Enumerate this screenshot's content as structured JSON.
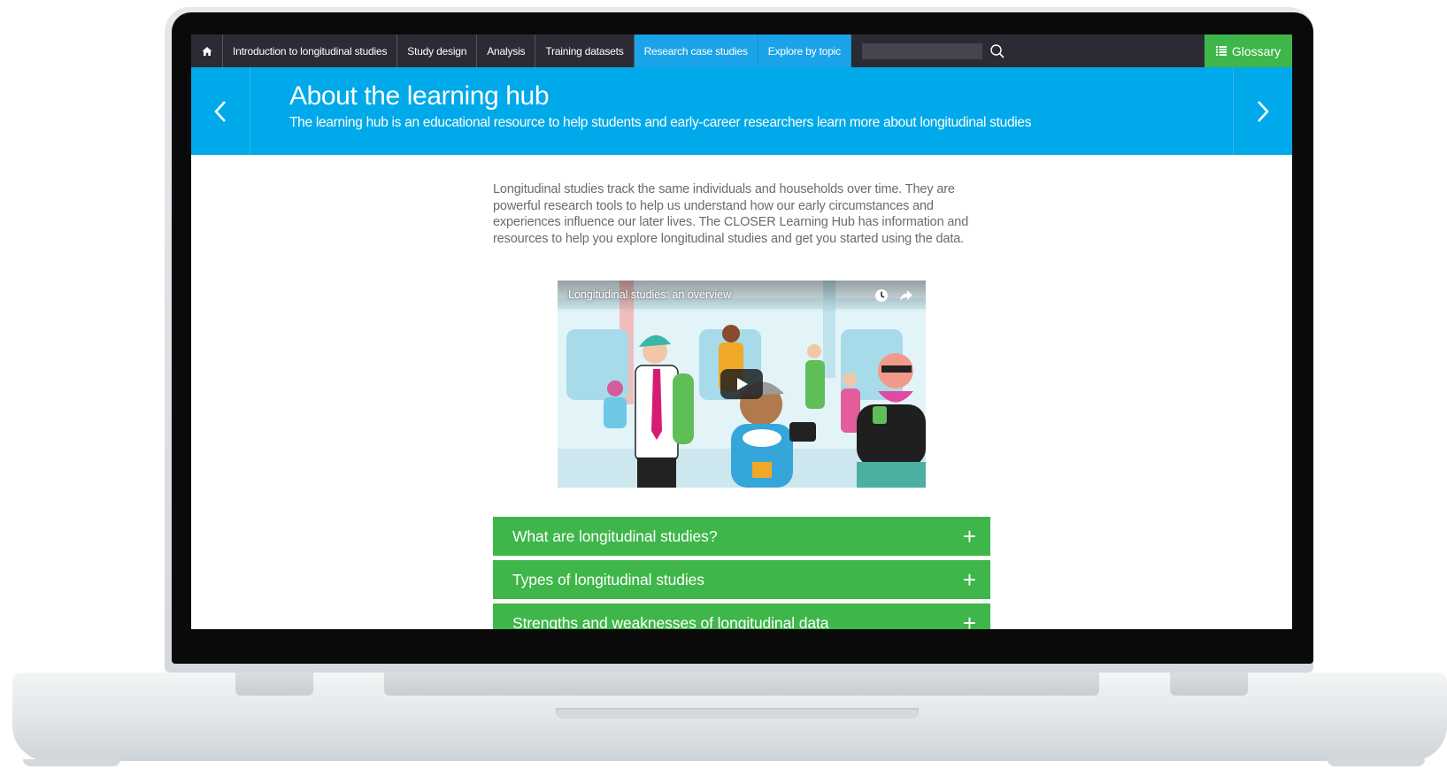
{
  "nav": {
    "home_icon": "home-icon",
    "items": [
      {
        "label": "Introduction to longitudinal studies"
      },
      {
        "label": "Study design"
      },
      {
        "label": "Analysis"
      },
      {
        "label": "Training datasets"
      },
      {
        "label": "Research case studies",
        "active": true
      },
      {
        "label": "Explore by topic",
        "active": true
      }
    ],
    "search": {
      "value": "",
      "icon": "search-icon"
    },
    "glossary_label": "Glossary",
    "glossary_icon": "list-icon"
  },
  "banner": {
    "title": "About the learning hub",
    "subtitle": "The learning hub is an educational resource to help students and early-career researchers learn more about longitudinal studies",
    "prev_icon": "chevron-left-icon",
    "next_icon": "chevron-right-icon"
  },
  "intro_text": "Longitudinal studies track the same individuals and households over time. They are powerful research tools to help us understand how our early circumstances and experiences influence our later lives.  The CLOSER Learning Hub has information and resources to help you explore longitudinal studies and get you started using the data.",
  "video": {
    "title": "Longitudinal studies: an overview",
    "watch_later_icon": "clock-icon",
    "share_icon": "share-icon",
    "play_icon": "play-icon"
  },
  "accordion": [
    {
      "label": "What are longitudinal studies?"
    },
    {
      "label": "Types of longitudinal studies"
    },
    {
      "label": "Strengths and weaknesses of longitudinal data"
    }
  ],
  "colors": {
    "nav_bg": "#2b2b35",
    "accent_blue": "#00a9e9",
    "accent_green": "#3eb649",
    "text_gray": "#6b6b6b"
  }
}
